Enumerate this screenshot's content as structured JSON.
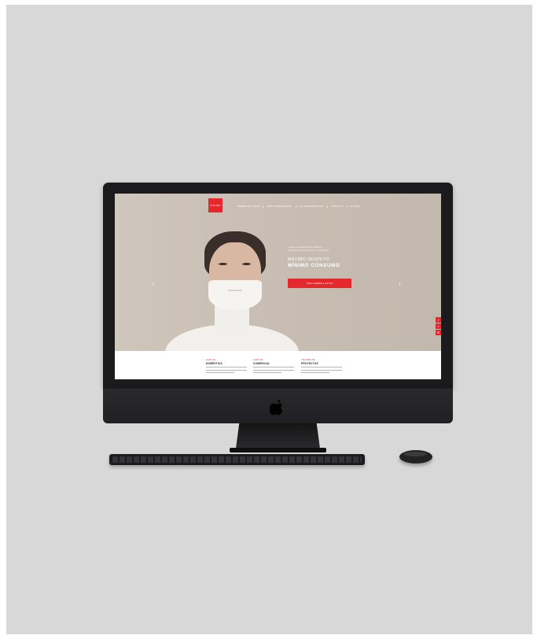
{
  "site": {
    "logo_text": "FUJITSU",
    "nav": [
      "BOMBAS DE CALOR",
      "AIRE ACONDICIONADO",
      "SALAS ENERGÉTICAS",
      "CONTACTO",
      "EL BLOG"
    ],
    "hero": {
      "small_line_1": "TODA LA CALIDAD DEL AIRE EN",
      "small_line_2": "UN EQUIPO SILENCIOSO Y EFICIENTE",
      "line1": "MÁXIMO RESPETO",
      "line2": "MÍNIMO CONSUMO",
      "button": "TODO SOBRE FUJITSU"
    },
    "arrows": {
      "prev": "‹",
      "next": "›"
    },
    "social": [
      "f",
      "t",
      "✉"
    ],
    "columns": [
      {
        "label": "GAMA DE",
        "title": "DOMÉSTICA"
      },
      {
        "label": "GAMA DE",
        "title": "COMERCIAL"
      },
      {
        "label": "GRANDES DE",
        "title": "PROYECTOS"
      }
    ]
  },
  "colors": {
    "accent": "#e5282e",
    "background": "#d8d8d8",
    "device": "#1b1b1d"
  }
}
